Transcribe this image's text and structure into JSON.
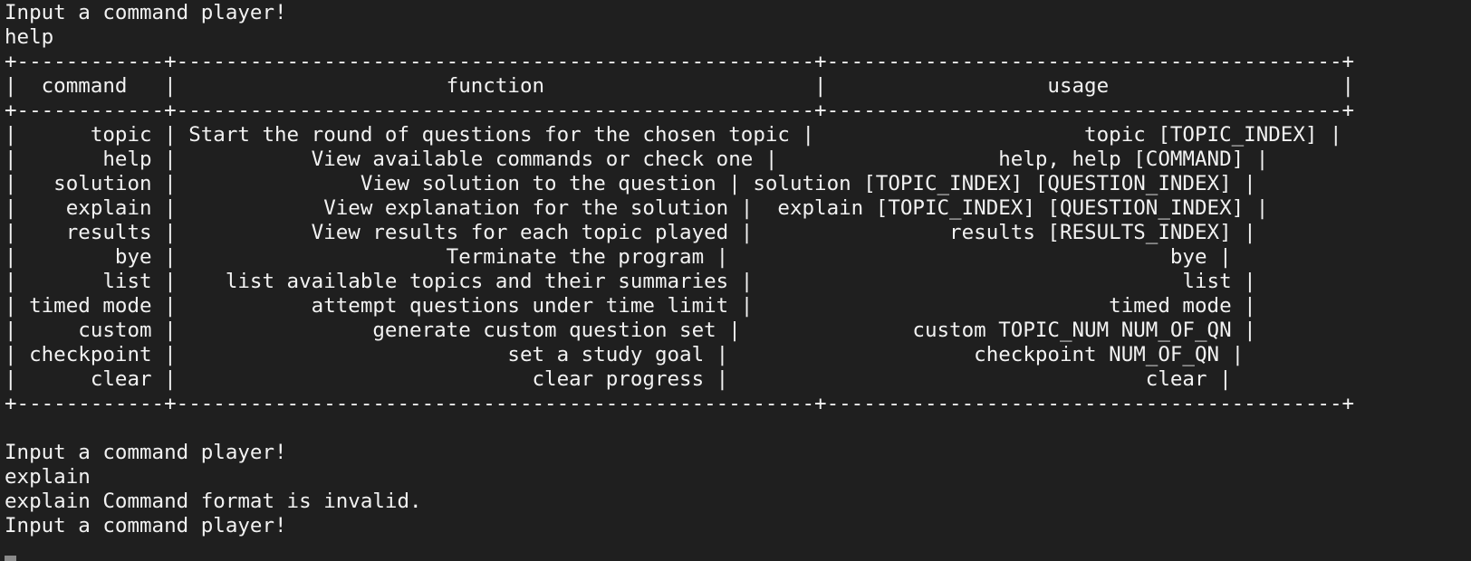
{
  "session": {
    "prompt_1": "Input a command player!",
    "input_1": "help",
    "border_line": "+------------+----------------------------------------------------+------------------------------------------+",
    "header_row": "|  command   |                      function                      |                  usage                   |",
    "rows": [
      "|      topic | Start the round of questions for the chosen topic |                      topic [TOPIC_INDEX] |",
      "|       help |           View available commands or check one |                  help, help [COMMAND] |",
      "|   solution |               View solution to the question | solution [TOPIC_INDEX] [QUESTION_INDEX] |",
      "|    explain |            View explanation for the solution |  explain [TOPIC_INDEX] [QUESTION_INDEX] |",
      "|    results |           View results for each topic played |                results [RESULTS_INDEX] |",
      "|        bye |                      Terminate the program |                                    bye |",
      "|       list |    list available topics and their summaries |                                   list |",
      "| timed mode |           attempt questions under time limit |                             timed mode |",
      "|     custom |                generate custom question set |              custom TOPIC_NUM NUM_OF_QN |",
      "| checkpoint |                           set a study goal |                    checkpoint NUM_OF_QN |",
      "|      clear |                             clear progress |                                  clear |"
    ],
    "prompt_2": "Input a command player!",
    "input_2": "explain",
    "error_line": "explain Command format is invalid.",
    "prompt_3": "Input a command player!"
  },
  "colors": {
    "background": "#1f1f1f",
    "foreground": "#f2f2f2",
    "cursor": "#8a8a8a"
  }
}
